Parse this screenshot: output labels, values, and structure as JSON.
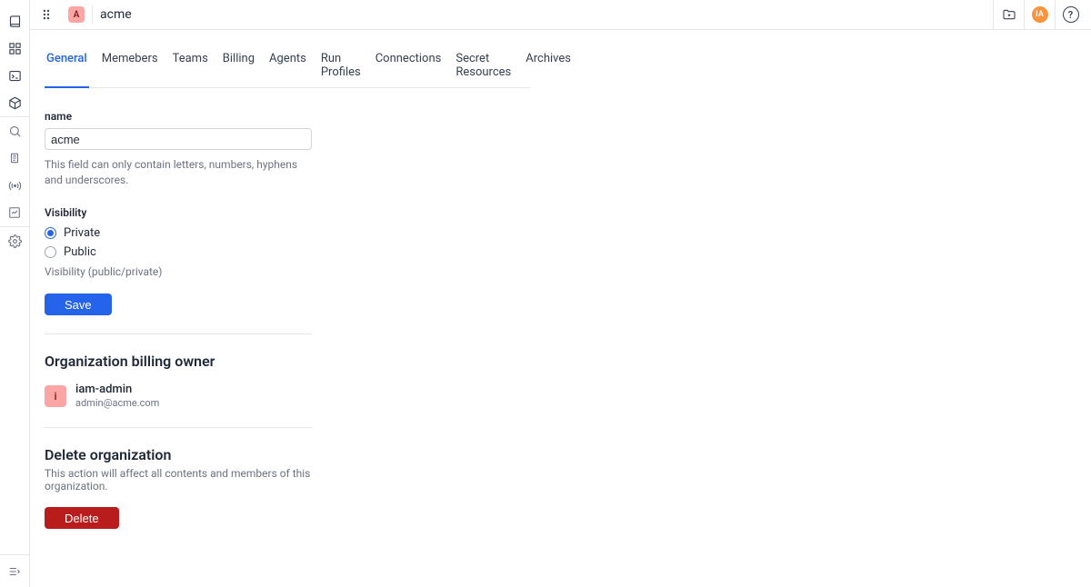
{
  "topbar": {
    "org_initial": "A",
    "org_name": "acme",
    "user_initials": "IA"
  },
  "tabs": {
    "general": "General",
    "members": "Memebers",
    "teams": "Teams",
    "billing": "Billing",
    "agents": "Agents",
    "run_profiles": "Run Profiles",
    "connections": "Connections",
    "secret_resources": "Secret Resources",
    "archives": "Archives"
  },
  "form": {
    "name_label": "name",
    "name_value": "acme",
    "name_helper": "This field can only contain letters, numbers, hyphens and underscores.",
    "visibility_label": "Visibility",
    "visibility_private": "Private",
    "visibility_public": "Public",
    "visibility_helper": "Visibility (public/private)",
    "save_label": "Save"
  },
  "billing_owner": {
    "heading": "Organization billing owner",
    "initial": "i",
    "name": "iam-admin",
    "email": "admin@acme.com"
  },
  "danger": {
    "heading": "Delete organization",
    "sub": "This action will affect all contents and members of this organization.",
    "delete_label": "Delete"
  }
}
